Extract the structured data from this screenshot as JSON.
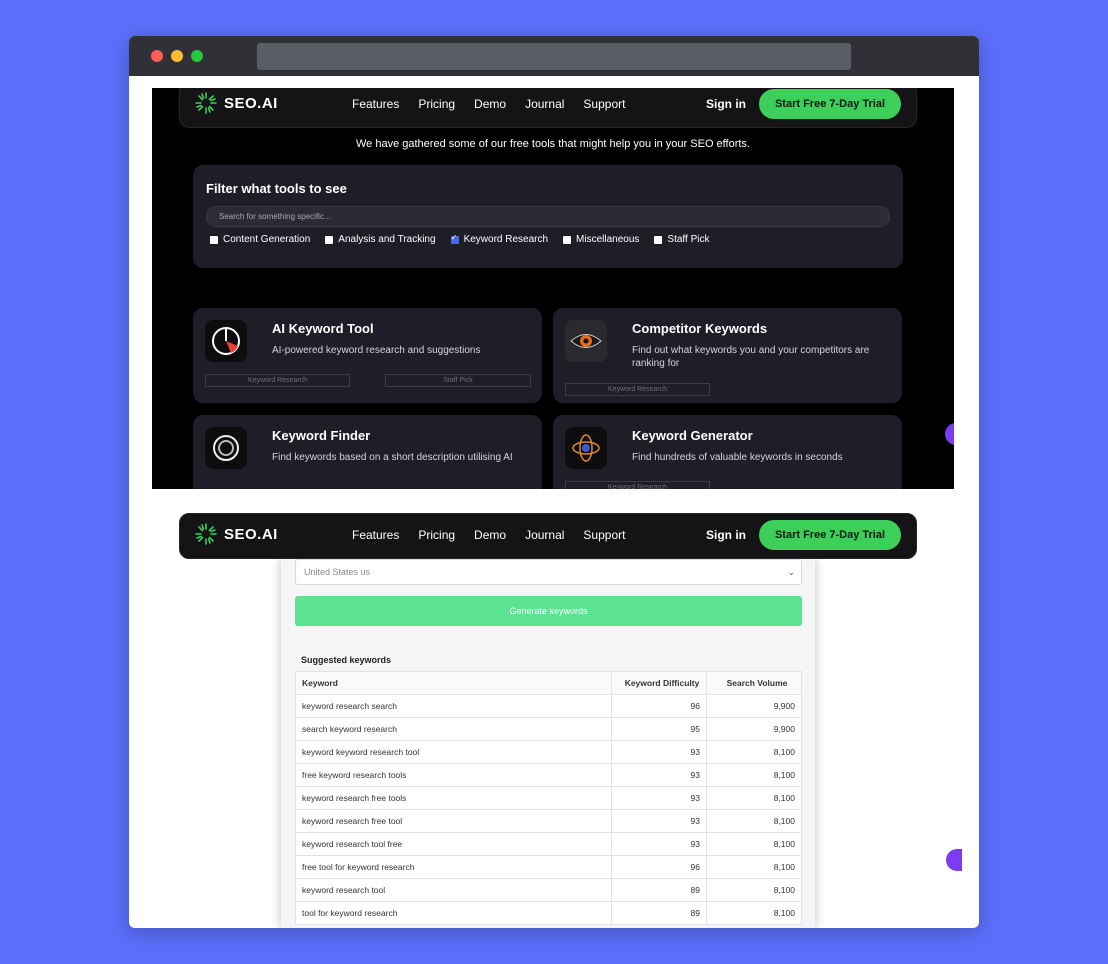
{
  "brand": {
    "name": "SEO.AI",
    "accent": "#3ccf5a"
  },
  "nav": {
    "links": [
      "Features",
      "Pricing",
      "Demo",
      "Journal",
      "Support"
    ],
    "signin": "Sign in",
    "cta": "Start Free 7-Day Trial"
  },
  "intro": "We have gathered some of our free tools that might help you in your SEO efforts.",
  "filter": {
    "title": "Filter what tools to see",
    "placeholder": "Search for something specific...",
    "options": [
      {
        "label": "Content Generation",
        "checked": false
      },
      {
        "label": "Analysis and Tracking",
        "checked": false
      },
      {
        "label": "Keyword Research",
        "checked": true
      },
      {
        "label": "Miscellaneous",
        "checked": false
      },
      {
        "label": "Staff Pick",
        "checked": false
      }
    ]
  },
  "tools": [
    {
      "title": "AI Keyword Tool",
      "desc": "AI-powered keyword research and suggestions",
      "tags": [
        "Keyword Research",
        "Staff Pick"
      ],
      "icon": "gauge-icon"
    },
    {
      "title": "Competitor Keywords",
      "desc": "Find out what keywords you and your competitors are ranking for",
      "tags": [
        "Keyword Research"
      ],
      "icon": "eye-icon"
    },
    {
      "title": "Keyword Finder",
      "desc": "Find keywords based on a short description utilising AI",
      "tags": [],
      "icon": "ring-icon"
    },
    {
      "title": "Keyword Generator",
      "desc": "Find hundreds of valuable keywords in seconds",
      "tags": [
        "Keyword Research"
      ],
      "icon": "orbit-icon"
    }
  ],
  "generator": {
    "country": "United States us",
    "button": "Generate keywords",
    "table_title": "Suggested keywords",
    "columns": [
      "Keyword",
      "Keyword Difficulty",
      "Search Volume"
    ],
    "rows": [
      [
        "keyword research search",
        "96",
        "9,900"
      ],
      [
        "search keyword research",
        "95",
        "9,900"
      ],
      [
        "keyword keyword research tool",
        "93",
        "8,100"
      ],
      [
        "free keyword research tools",
        "93",
        "8,100"
      ],
      [
        "keyword research free tools",
        "93",
        "8,100"
      ],
      [
        "keyword research free tool",
        "93",
        "8,100"
      ],
      [
        "keyword research tool free",
        "93",
        "8,100"
      ],
      [
        "free tool for keyword research",
        "96",
        "8,100"
      ],
      [
        "keyword research tool",
        "89",
        "8,100"
      ],
      [
        "tool for keyword research",
        "89",
        "8,100"
      ]
    ]
  }
}
